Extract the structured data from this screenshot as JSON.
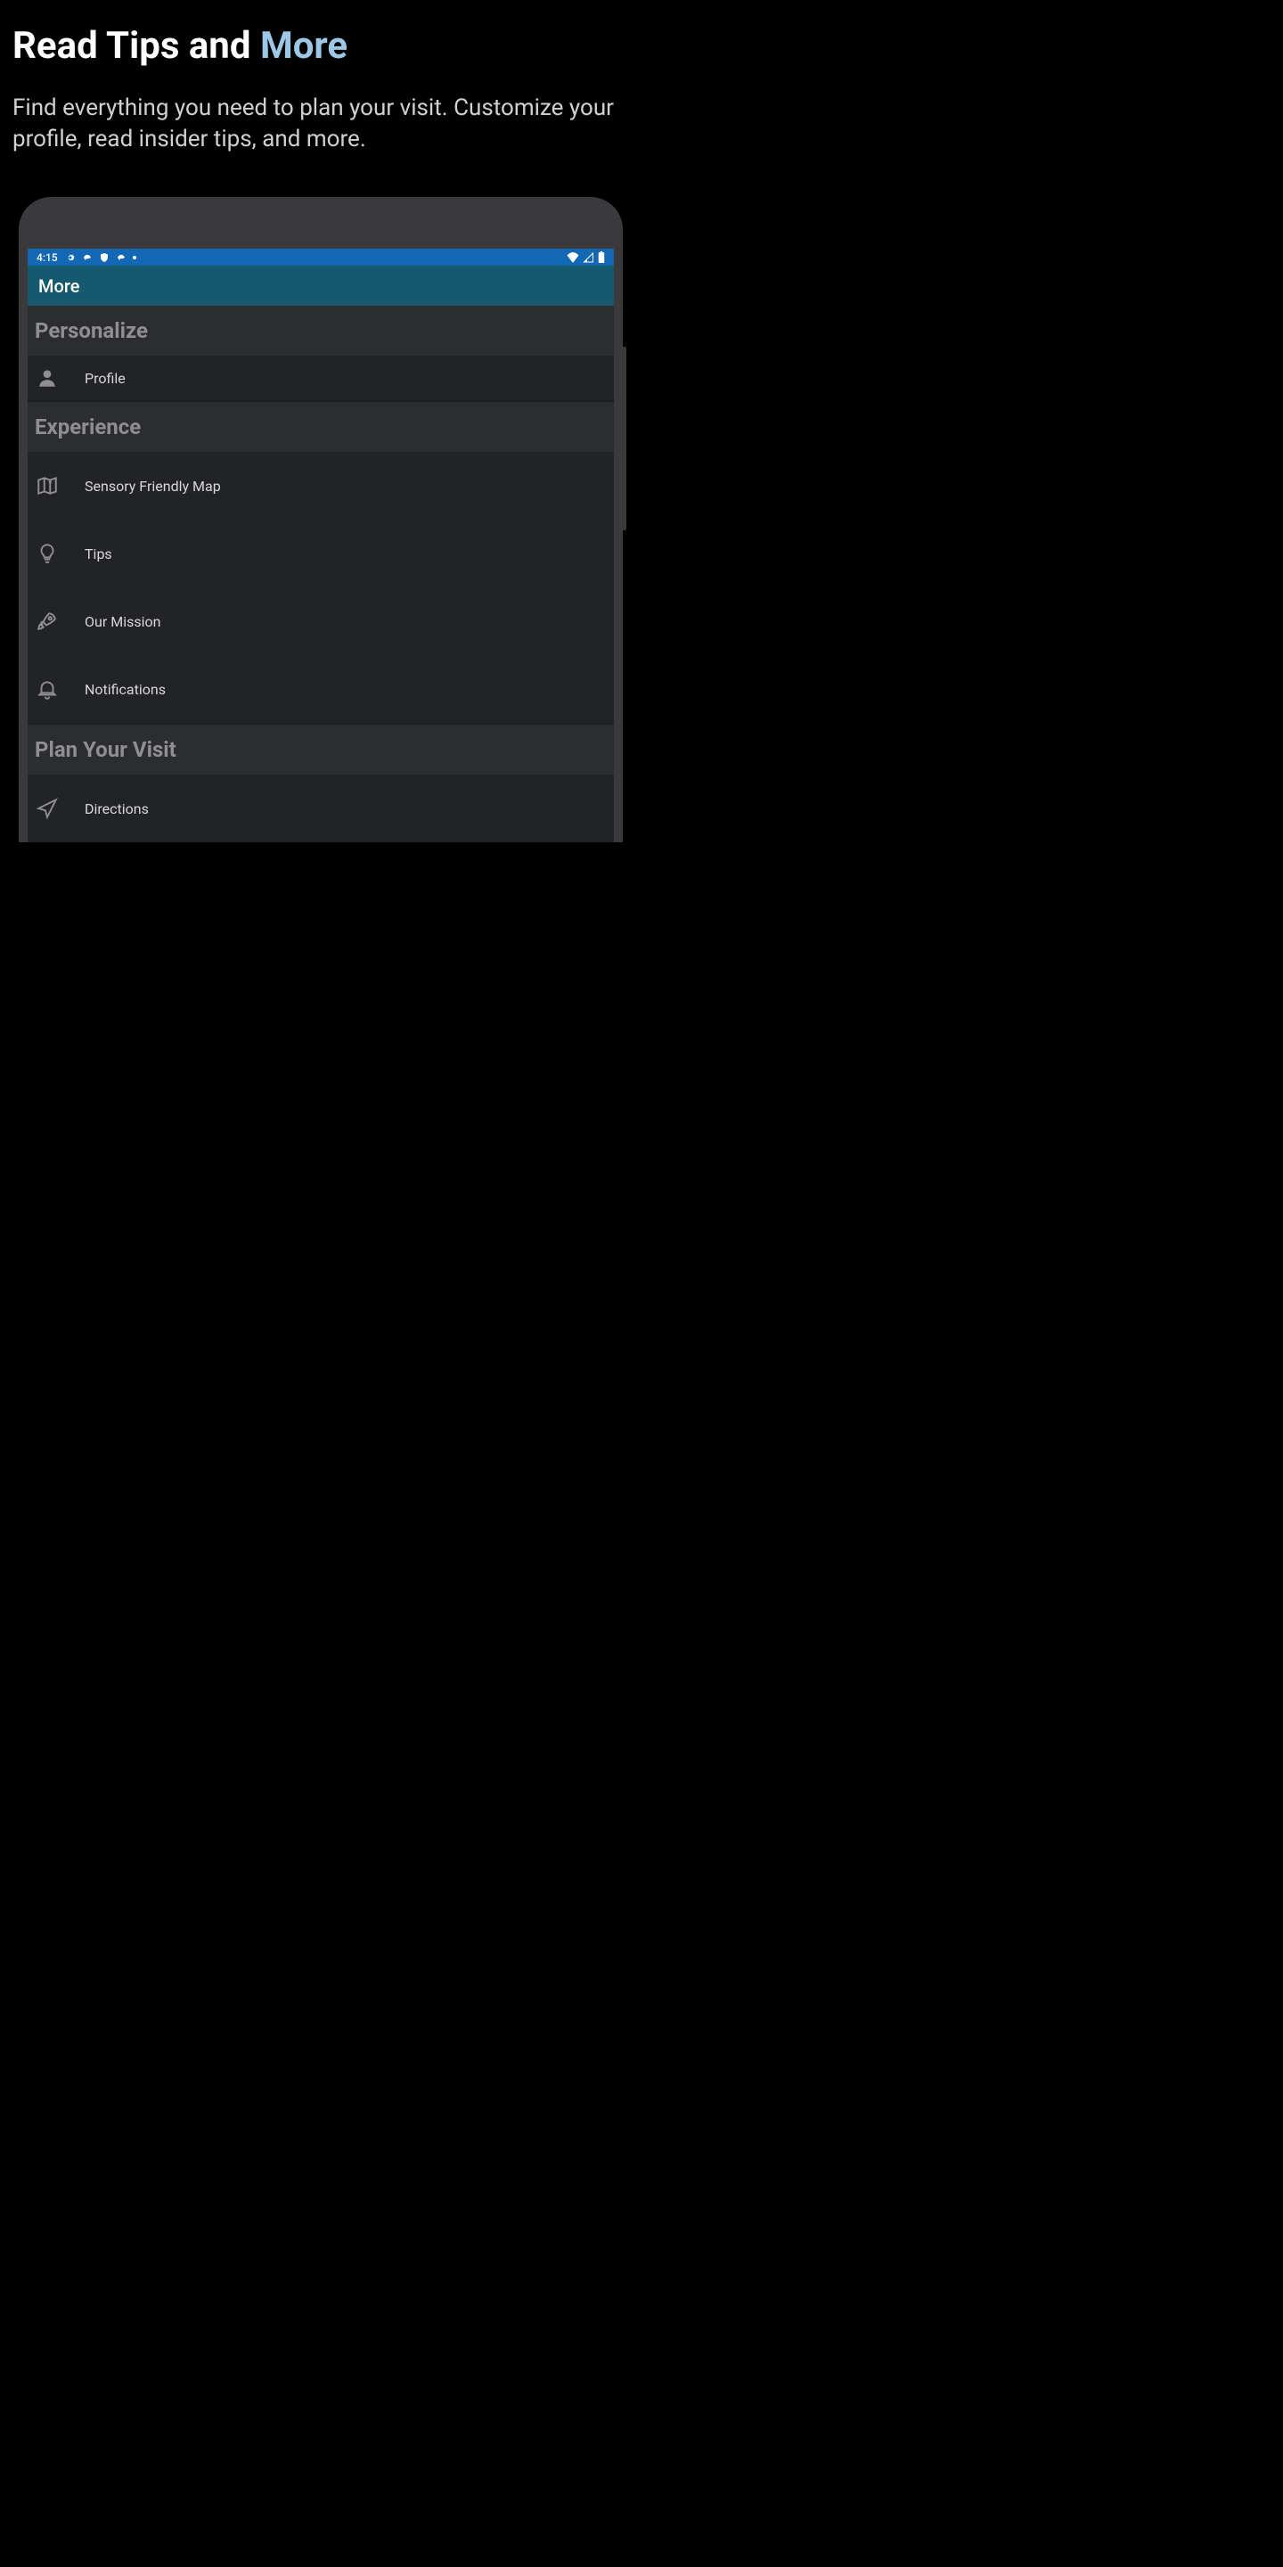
{
  "page": {
    "title_prefix": "Read Tips and ",
    "title_accent": "More",
    "subtitle": "Find everything you need to plan your visit. Customize your profile, read insider tips, and more."
  },
  "status_bar": {
    "time": "4:15"
  },
  "app_bar": {
    "title": "More"
  },
  "sections": {
    "personalize": {
      "header": "Personalize",
      "items": {
        "profile": "Profile"
      }
    },
    "experience": {
      "header": "Experience",
      "items": {
        "sensory_map": "Sensory Friendly Map",
        "tips": "Tips",
        "our_mission": "Our Mission",
        "notifications": "Notifications"
      }
    },
    "plan_visit": {
      "header": "Plan Your Visit",
      "items": {
        "directions": "Directions"
      }
    }
  }
}
